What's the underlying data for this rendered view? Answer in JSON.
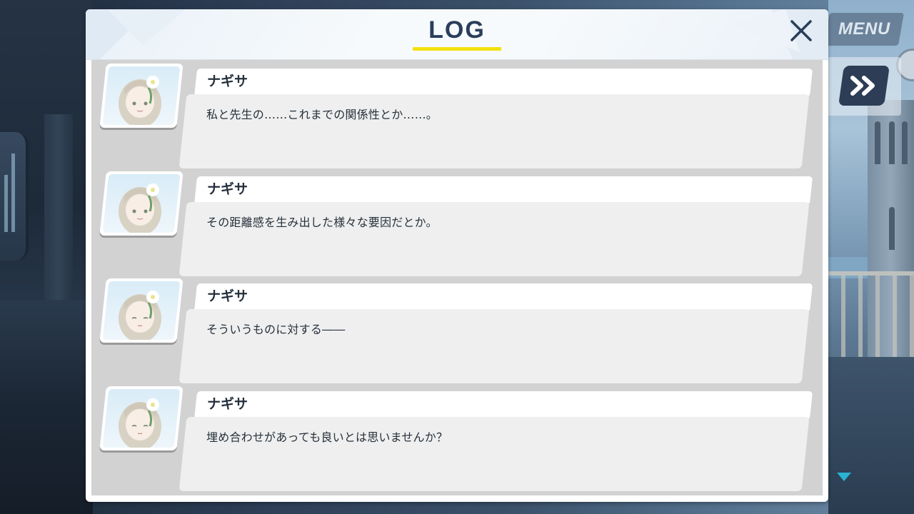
{
  "hud": {
    "menu_label": "MENU",
    "fast_forward_icon": "double-chevron-right-icon",
    "scroll_indicator_icon": "triangle-down-icon"
  },
  "log": {
    "title": "LOG",
    "close_icon": "close-icon",
    "accent_color": "#f2e10f",
    "title_color": "#2a3e5a",
    "entries": [
      {
        "speaker": "ナギサ",
        "text": "私と先生の……これまでの関係性とか……。"
      },
      {
        "speaker": "ナギサ",
        "text": "その距離感を生み出した様々な要因だとか。"
      },
      {
        "speaker": "ナギサ",
        "text": "そういうものに対する――"
      },
      {
        "speaker": "ナギサ",
        "text": "埋め合わせがあっても良いとは思いませんか？"
      }
    ]
  }
}
